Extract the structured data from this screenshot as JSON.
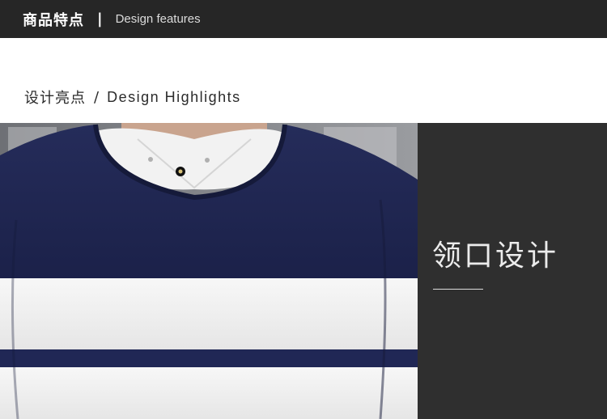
{
  "header": {
    "title_cn": "商品特点",
    "separator": "|",
    "title_en": "Design features"
  },
  "section": {
    "title_cn": "设计亮点",
    "separator": "/",
    "title_en": "Design Highlights"
  },
  "feature": {
    "label": "领口设计"
  },
  "colors": {
    "header_bg": "#262626",
    "panel_bg": "#2f2f2f",
    "sweater_navy": "#1f2650",
    "sweater_white": "#f4f4f4"
  }
}
